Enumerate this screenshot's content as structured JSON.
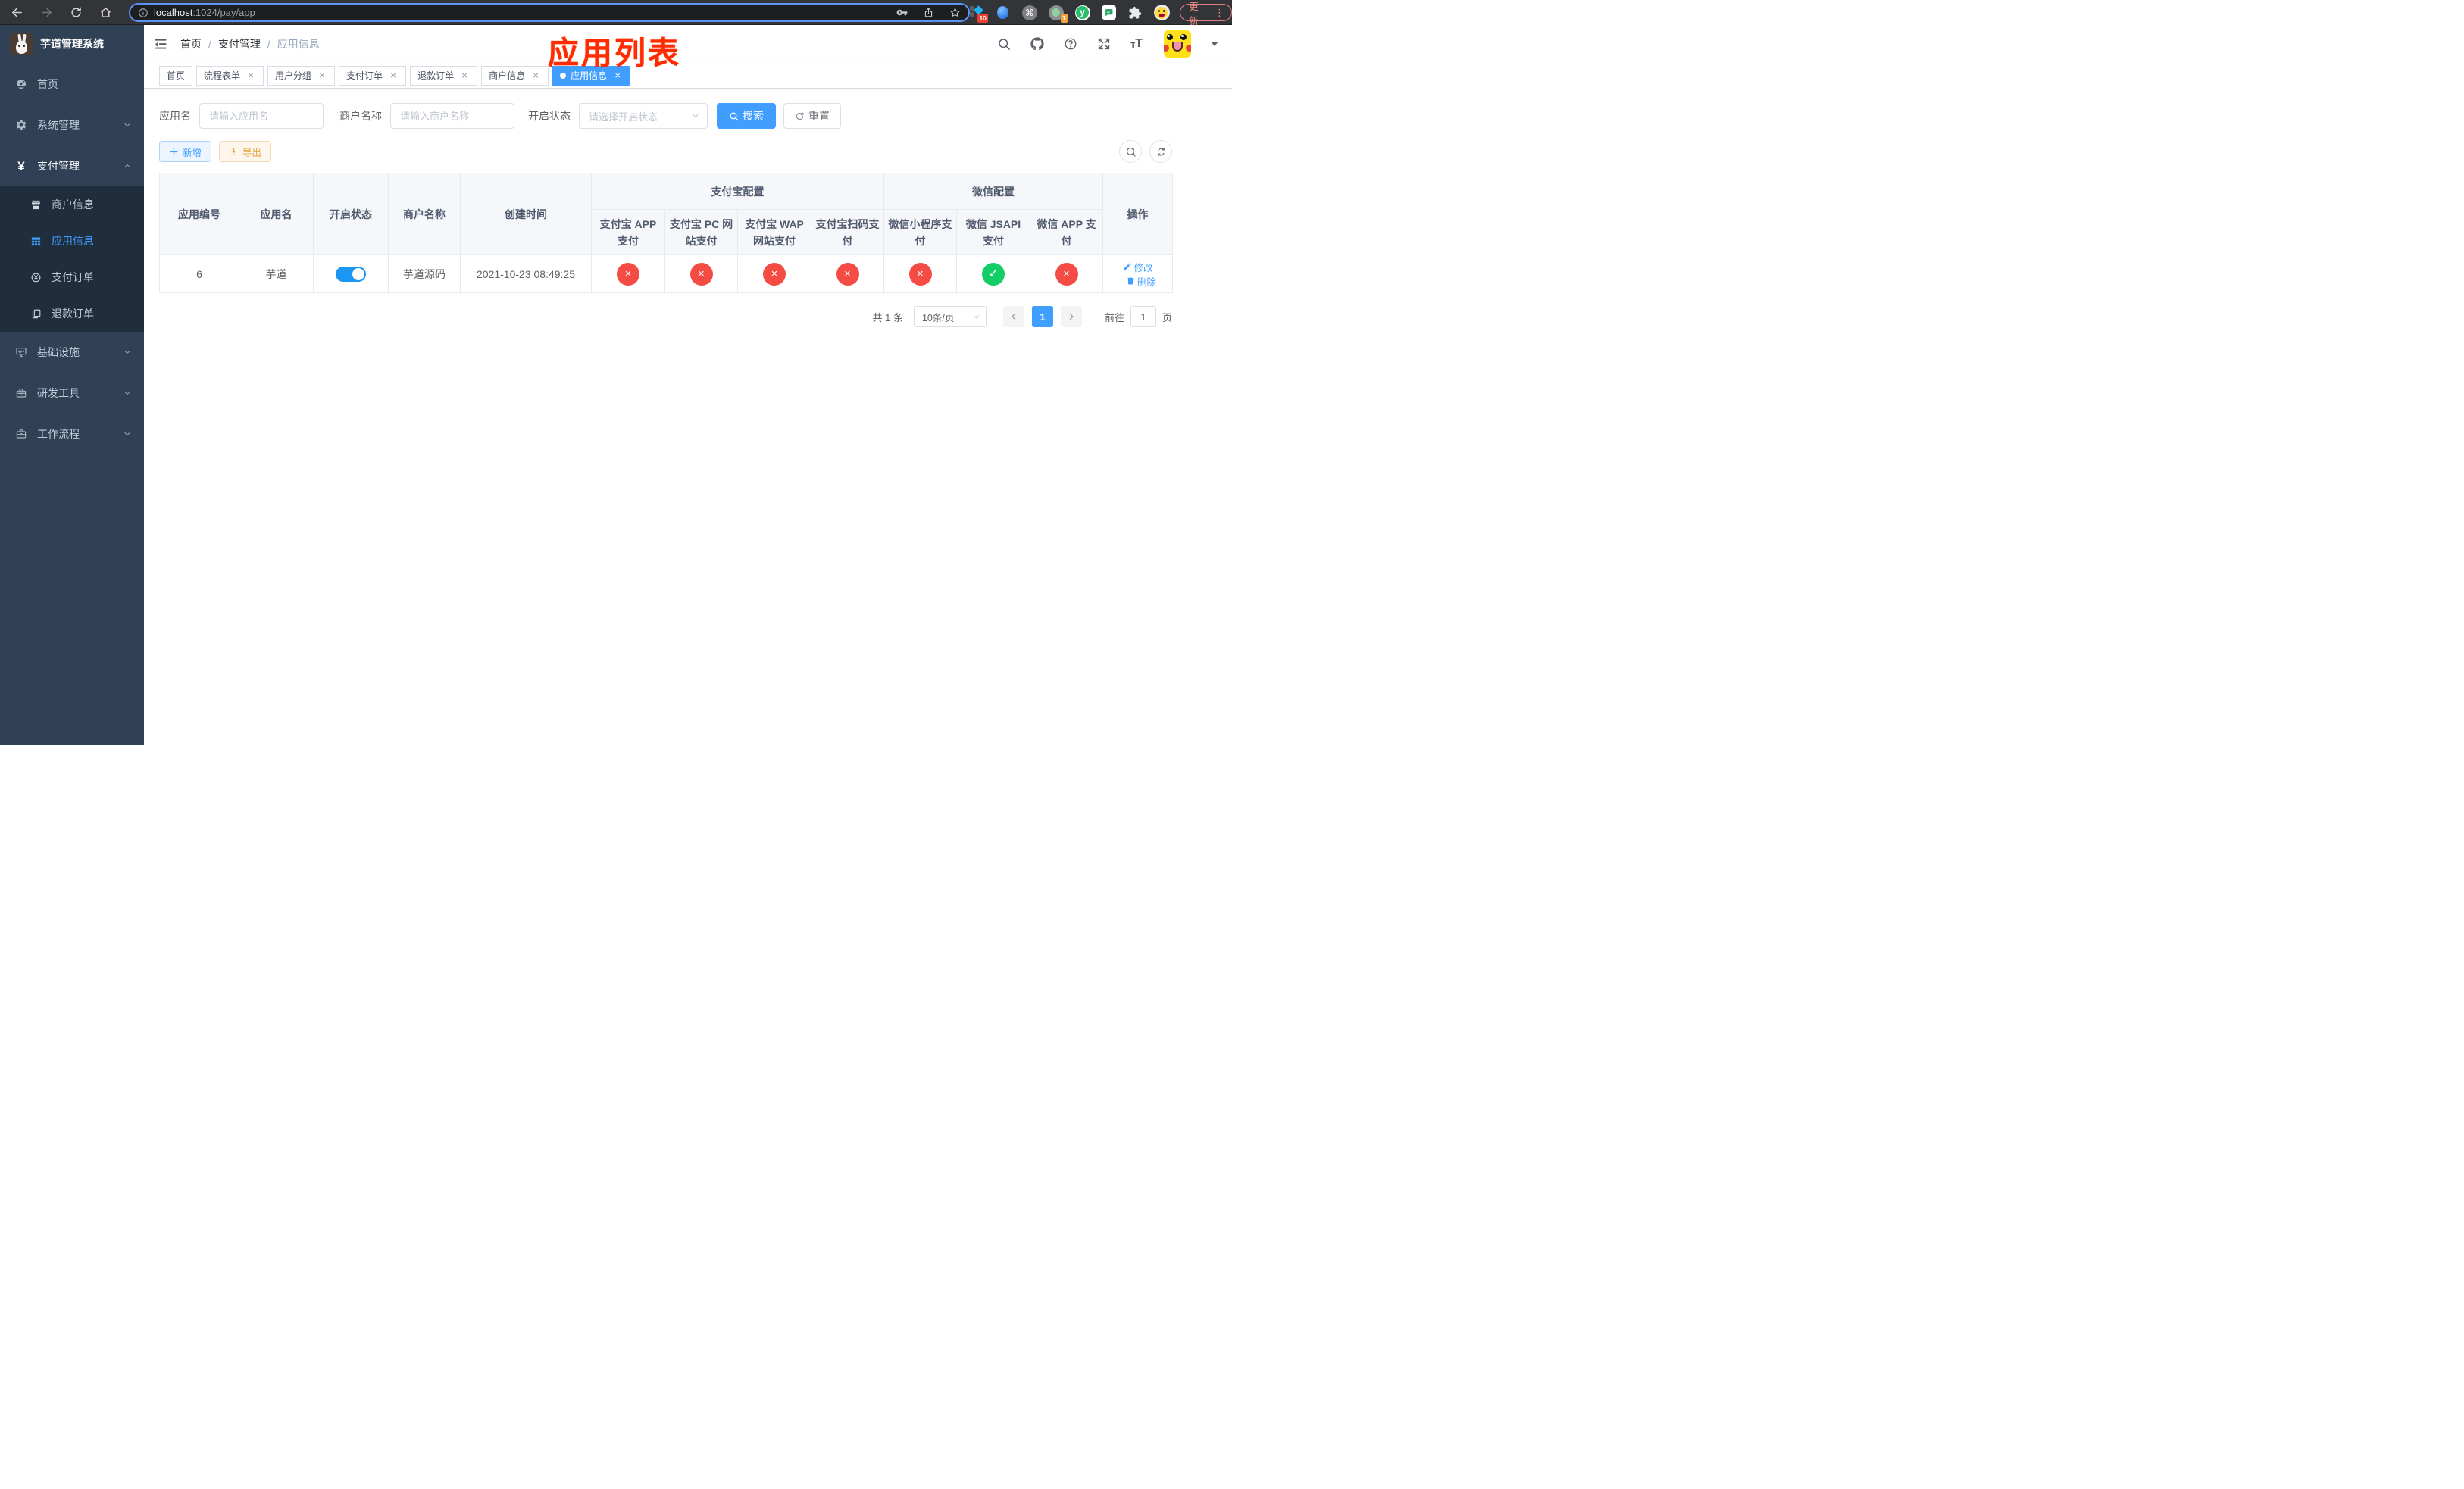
{
  "colors": {
    "primary": "#409eff",
    "danger": "#f44c44",
    "success": "#13ce66",
    "warning": "#e6a23c",
    "annotation_red": "#fe2c01",
    "sidebar_bg": "#304156",
    "submenu_bg": "#1f2d3d"
  },
  "browser": {
    "url_host": "localhost",
    "url_rest": ":1024/pay/app",
    "update_label": "更新",
    "menu_dots": "⋮",
    "ext_badge_docs": "10",
    "ext_badge_recorder": "1",
    "yuque_letter": "y",
    "command_glyph": "⌘"
  },
  "sidebar": {
    "logo_title": "芋道管理系统",
    "items": [
      {
        "label": "首页"
      },
      {
        "label": "系统管理"
      },
      {
        "label": "支付管理"
      },
      {
        "label": "基础设施"
      },
      {
        "label": "研发工具"
      },
      {
        "label": "工作流程"
      }
    ],
    "submenu": [
      {
        "label": "商户信息"
      },
      {
        "label": "应用信息"
      },
      {
        "label": "支付订单"
      },
      {
        "label": "退款订单"
      }
    ],
    "yen_glyph": "¥"
  },
  "navbar": {
    "breadcrumb": [
      "首页",
      "支付管理",
      "应用信息"
    ],
    "annotation": "应用列表"
  },
  "tabs": [
    {
      "label": "首页"
    },
    {
      "label": "流程表单"
    },
    {
      "label": "用户分组"
    },
    {
      "label": "支付订单"
    },
    {
      "label": "退款订单"
    },
    {
      "label": "商户信息"
    },
    {
      "label": "应用信息"
    }
  ],
  "filters": {
    "app_name_label": "应用名",
    "app_name_placeholder": "请输入应用名",
    "merchant_label": "商户名称",
    "merchant_placeholder": "请输入商户名称",
    "status_label": "开启状态",
    "status_placeholder": "请选择开启状态",
    "search_label": "搜索",
    "reset_label": "重置"
  },
  "toolbar": {
    "add_label": "新增",
    "export_label": "导出"
  },
  "table": {
    "col_app_id": "应用编号",
    "col_app_name": "应用名",
    "col_enabled": "开启状态",
    "col_merchant": "商户名称",
    "col_created": "创建时间",
    "group_alipay": "支付宝配置",
    "group_wechat": "微信配置",
    "col_alipay_app": "支付宝 APP 支付",
    "col_alipay_pc": "支付宝 PC 网站支付",
    "col_alipay_wap": "支付宝 WAP 网站支付",
    "col_alipay_qr": "支付宝扫码支付",
    "col_wx_mini": "微信小程序支付",
    "col_wx_jsapi": "微信 JSAPI 支付",
    "col_wx_app": "微信 APP 支付",
    "col_actions": "操作",
    "status_true_glyph": "✓",
    "status_false_glyph": "×",
    "row": {
      "id": "6",
      "name": "芋道",
      "enabled": true,
      "merchant": "芋道源码",
      "created": "2021-10-23 08:49:25",
      "statuses": [
        false,
        false,
        false,
        false,
        false,
        true,
        false
      ],
      "edit_label": "修改",
      "delete_label": "删除"
    }
  },
  "pagination": {
    "total": "共 1 条",
    "page_size": "10条/页",
    "current_page": "1",
    "goto_label": "前往",
    "goto_value": "1",
    "unit_label": "页"
  }
}
